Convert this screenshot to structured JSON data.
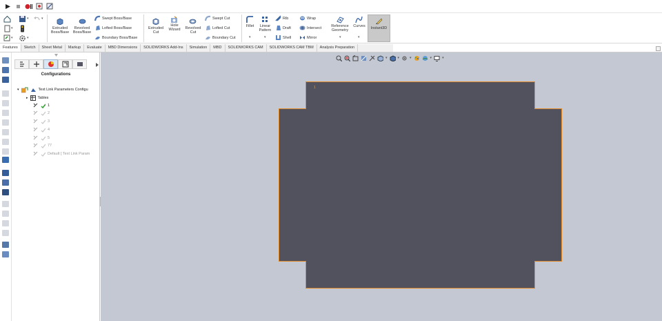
{
  "ribbon": {
    "extruded_boss": "Extruded\nBoss/Base",
    "revolved_boss": "Revolved\nBoss/Base",
    "swept_boss": "Swept Boss/Base",
    "lofted_boss": "Lofted Boss/Base",
    "boundary_boss": "Boundary Boss/Base",
    "extruded_cut": "Extruded\nCut",
    "hole_wizard": "Hole\nWizard",
    "revolved_cut": "Revolved\nCut",
    "swept_cut": "Swept Cut",
    "lofted_cut": "Lofted Cut",
    "boundary_cut": "Boundary Cut",
    "fillet": "Fillet",
    "linear_pattern": "Linear\nPattern",
    "rib": "Rib",
    "draft": "Draft",
    "shell": "Shell",
    "wrap": "Wrap",
    "intersect": "Intersect",
    "mirror": "Mirror",
    "reference_geometry": "Reference\nGeometry",
    "curves": "Curves",
    "instant3d": "Instant3D"
  },
  "tabs": [
    "Features",
    "Sketch",
    "Sheet Metal",
    "Markup",
    "Evaluate",
    "MBD Dimensions",
    "SOLIDWORKS Add-Ins",
    "Simulation",
    "MBD",
    "SOLIDWORKS CAM",
    "SOLIDWORKS CAM TBM",
    "Analysis Preparation"
  ],
  "panel": {
    "title": "Configurations",
    "root": "Text Link Parameters Configu",
    "tables": "Tables",
    "configs": [
      "1",
      "2",
      "3",
      "4",
      "5",
      "77"
    ],
    "default": "Default [ Text Link Param"
  },
  "viewport": {
    "marker": "1"
  },
  "colors": {
    "part_fill": "#51525e",
    "part_edge": "#e08a2a",
    "background": "#c4c8d3",
    "active_check": "#2f9e2f"
  }
}
